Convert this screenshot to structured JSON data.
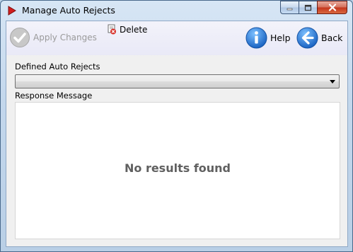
{
  "window": {
    "title": "Manage Auto Rejects"
  },
  "toolbar": {
    "apply_label": "Apply Changes",
    "delete_label": "Delete",
    "help_label": "Help",
    "back_label": "Back"
  },
  "form": {
    "defined_label": "Defined Auto Rejects",
    "defined_value": "",
    "response_label": "Response Message"
  },
  "results": {
    "empty_text": "No results found"
  },
  "icons": {
    "app": "red-arrow-icon",
    "apply": "checkmark-circle-icon",
    "delete": "delete-document-icon",
    "help": "info-icon",
    "back": "back-arrow-icon"
  },
  "colors": {
    "accent": "#2f7fd8",
    "disabled_text": "#9a9a9a",
    "close_button": "#c4361d"
  }
}
